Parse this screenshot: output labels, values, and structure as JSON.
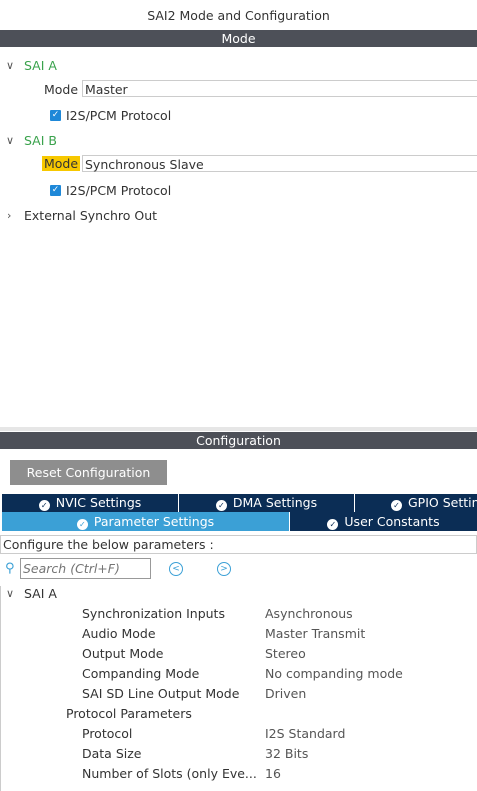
{
  "title": "SAI2 Mode and Configuration",
  "mode_bar": "Mode",
  "sai_a": {
    "label": "SAI A",
    "mode_label": "Mode",
    "mode_value": "Master",
    "protocol_label": "I2S/PCM Protocol",
    "protocol_checked": true
  },
  "sai_b": {
    "label": "SAI B",
    "mode_label": "Mode",
    "mode_value": "Synchronous Slave",
    "protocol_label": "I2S/PCM Protocol",
    "protocol_checked": true
  },
  "external_synchro": "External Synchro Out",
  "config_bar": "Configuration",
  "reset_button": "Reset Configuration",
  "tabs_row1": [
    "NVIC Settings",
    "DMA Settings",
    "GPIO Settings"
  ],
  "tabs_row2": [
    "Parameter Settings",
    "User Constants"
  ],
  "configure_text": "Configure the below parameters :",
  "search_placeholder": "Search (Ctrl+F)",
  "params": {
    "group": "SAI A",
    "rows": [
      {
        "name": "Synchronization Inputs",
        "value": "Asynchronous"
      },
      {
        "name": "Audio Mode",
        "value": "Master Transmit"
      },
      {
        "name": "Output Mode",
        "value": "Stereo"
      },
      {
        "name": "Companding Mode",
        "value": "No companding mode"
      },
      {
        "name": "SAI SD Line Output Mode",
        "value": "Driven"
      }
    ],
    "subgroup": "Protocol Parameters",
    "protocol_rows": [
      {
        "name": "Protocol",
        "value": "I2S Standard"
      },
      {
        "name": "Data Size",
        "value": "32 Bits"
      },
      {
        "name": "Number of Slots (only Eve...",
        "value": "16"
      }
    ]
  },
  "colors": {
    "accent_green": "#3aa24c",
    "tab_dark": "#0b2d55",
    "tab_active": "#3ba0d6",
    "highlight": "#f7c800"
  }
}
